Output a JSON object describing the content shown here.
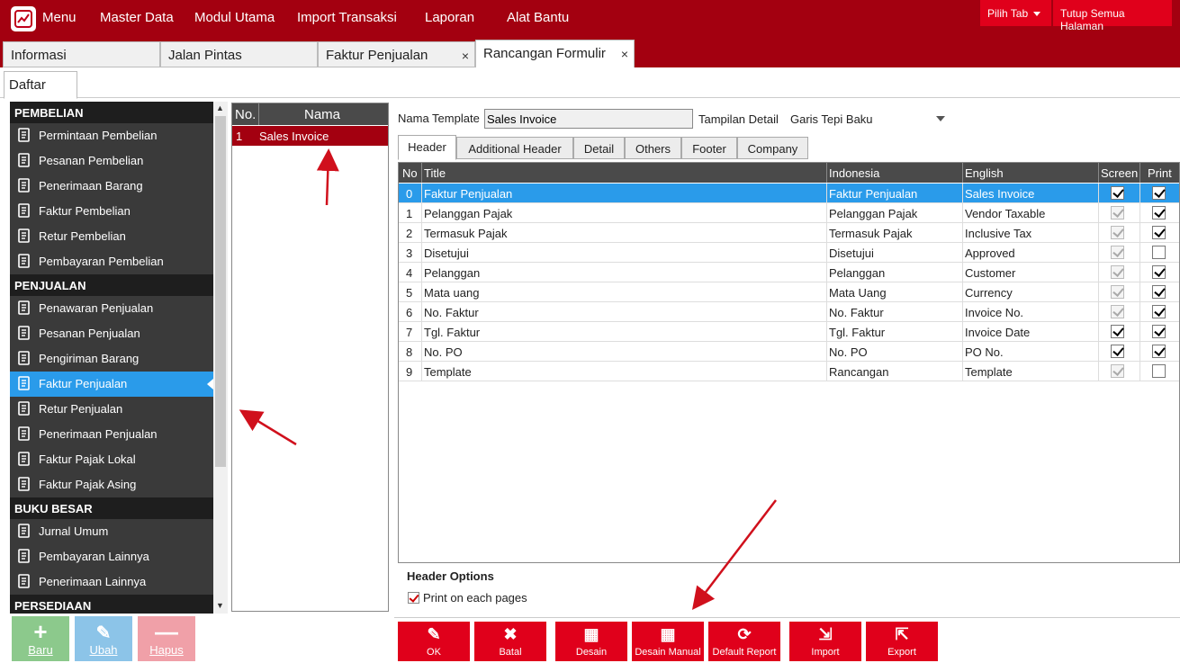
{
  "topbar": {
    "menu_label": "Menu",
    "items": [
      "Master Data",
      "Modul Utama",
      "Import Transaksi",
      "Laporan",
      "Alat Bantu"
    ],
    "pilih_tab": "Pilih Tab",
    "tutup_semua": "Tutup Semua Halaman"
  },
  "tabs": [
    {
      "label": "Informasi"
    },
    {
      "label": "Jalan Pintas"
    },
    {
      "label": "Faktur Penjualan",
      "close": "×"
    },
    {
      "label": "Rancangan Formulir",
      "close": "×"
    }
  ],
  "subtab": "Daftar",
  "sidebar": {
    "sections": [
      {
        "title": "PEMBELIAN",
        "items": [
          {
            "label": "Permintaan Pembelian",
            "icon": "document-edit-icon"
          },
          {
            "label": "Pesanan Pembelian",
            "icon": "order-icon"
          },
          {
            "label": "Penerimaan Barang",
            "icon": "truck-icon"
          },
          {
            "label": "Faktur Pembelian",
            "icon": "invoice-icon"
          },
          {
            "label": "Retur Pembelian",
            "icon": "return-icon"
          },
          {
            "label": "Pembayaran Pembelian",
            "icon": "payment-icon"
          }
        ]
      },
      {
        "title": "PENJUALAN",
        "items": [
          {
            "label": "Penawaran Penjualan",
            "icon": "document-edit-icon"
          },
          {
            "label": "Pesanan Penjualan",
            "icon": "order-icon"
          },
          {
            "label": "Pengiriman Barang",
            "icon": "truck-icon"
          },
          {
            "label": "Faktur Penjualan",
            "icon": "printer-icon",
            "active": true
          },
          {
            "label": "Retur Penjualan",
            "icon": "return-icon"
          },
          {
            "label": "Penerimaan Penjualan",
            "icon": "handshake-icon"
          },
          {
            "label": "Faktur Pajak Lokal",
            "icon": "printer-icon"
          },
          {
            "label": "Faktur Pajak Asing",
            "icon": "printer-icon"
          }
        ]
      },
      {
        "title": "BUKU BESAR",
        "items": [
          {
            "label": "Jurnal Umum",
            "icon": "journal-icon"
          },
          {
            "label": "Pembayaran Lainnya",
            "icon": "hand-pay-icon"
          },
          {
            "label": "Penerimaan Lainnya",
            "icon": "money-icon"
          }
        ]
      },
      {
        "title": "PERSEDIAAN",
        "items": []
      }
    ]
  },
  "left_buttons": [
    {
      "label": "Baru",
      "glyph": "+",
      "color": "#8cc98c"
    },
    {
      "label": "Ubah",
      "glyph": "✎",
      "color": "#8cc4e8"
    },
    {
      "label": "Hapus",
      "glyph": "—",
      "color": "#f0a0a8"
    }
  ],
  "template_list": {
    "col_no": "No.",
    "col_nama": "Nama",
    "rows": [
      {
        "no": "1",
        "nama": "Sales Invoice"
      }
    ]
  },
  "form": {
    "nama_template_label": "Nama Template",
    "nama_template_value": "Sales Invoice",
    "tampilan_detail_label": "Tampilan Detail",
    "tampilan_detail_value": "Garis Tepi Baku"
  },
  "detail_tabs": [
    "Header",
    "Additional Header",
    "Detail",
    "Others",
    "Footer",
    "Company"
  ],
  "grid": {
    "columns": [
      "No",
      "Title",
      "Indonesia",
      "English",
      "Screen",
      "Print"
    ],
    "rows": [
      {
        "no": "0",
        "title": "Faktur Penjualan",
        "indonesia": "Faktur Penjualan",
        "english": "Sales Invoice",
        "screen": true,
        "screen_enabled": true,
        "print": true
      },
      {
        "no": "1",
        "title": "Pelanggan Pajak",
        "indonesia": "Pelanggan Pajak",
        "english": "Vendor Taxable",
        "screen": true,
        "screen_enabled": false,
        "print": true
      },
      {
        "no": "2",
        "title": "Termasuk Pajak",
        "indonesia": "Termasuk Pajak",
        "english": "Inclusive Tax",
        "screen": true,
        "screen_enabled": false,
        "print": true
      },
      {
        "no": "3",
        "title": "Disetujui",
        "indonesia": "Disetujui",
        "english": "Approved",
        "screen": true,
        "screen_enabled": false,
        "print": false
      },
      {
        "no": "4",
        "title": "Pelanggan",
        "indonesia": "Pelanggan",
        "english": "Customer",
        "screen": true,
        "screen_enabled": false,
        "print": true
      },
      {
        "no": "5",
        "title": "Mata uang",
        "indonesia": "Mata Uang",
        "english": "Currency",
        "screen": true,
        "screen_enabled": false,
        "print": true
      },
      {
        "no": "6",
        "title": "No. Faktur",
        "indonesia": "No. Faktur",
        "english": "Invoice No.",
        "screen": true,
        "screen_enabled": false,
        "print": true
      },
      {
        "no": "7",
        "title": "Tgl. Faktur",
        "indonesia": "Tgl. Faktur",
        "english": "Invoice Date",
        "screen": true,
        "screen_enabled": true,
        "print": true
      },
      {
        "no": "8",
        "title": "No. PO",
        "indonesia": "No. PO",
        "english": "PO No.",
        "screen": true,
        "screen_enabled": true,
        "print": true
      },
      {
        "no": "9",
        "title": "Template",
        "indonesia": "Rancangan",
        "english": "Template",
        "screen": true,
        "screen_enabled": false,
        "print": false
      }
    ]
  },
  "header_options": {
    "title": "Header Options",
    "print_each_page_label": "Print on each pages",
    "print_each_page": true
  },
  "action_buttons": [
    {
      "label": "OK",
      "glyph": "✎",
      "icon": "pencil-icon"
    },
    {
      "label": "Batal",
      "glyph": "✖",
      "icon": "close-icon"
    },
    {
      "label": "Desain",
      "glyph": "▦",
      "icon": "design-icon"
    },
    {
      "label": "Desain Manual",
      "glyph": "▦",
      "icon": "design-manual-icon"
    },
    {
      "label": "Default Report",
      "glyph": "⟳",
      "icon": "refresh-icon"
    },
    {
      "label": "Import",
      "glyph": "⇲",
      "icon": "import-icon"
    },
    {
      "label": "Export",
      "glyph": "⇱",
      "icon": "export-icon"
    }
  ],
  "colors": {
    "brand": "#a30010",
    "accent_red": "#e0001b",
    "selection_blue": "#2a9bea",
    "sidebar_bg": "#3a3a3a",
    "annotation_arrow": "#d0101c"
  }
}
